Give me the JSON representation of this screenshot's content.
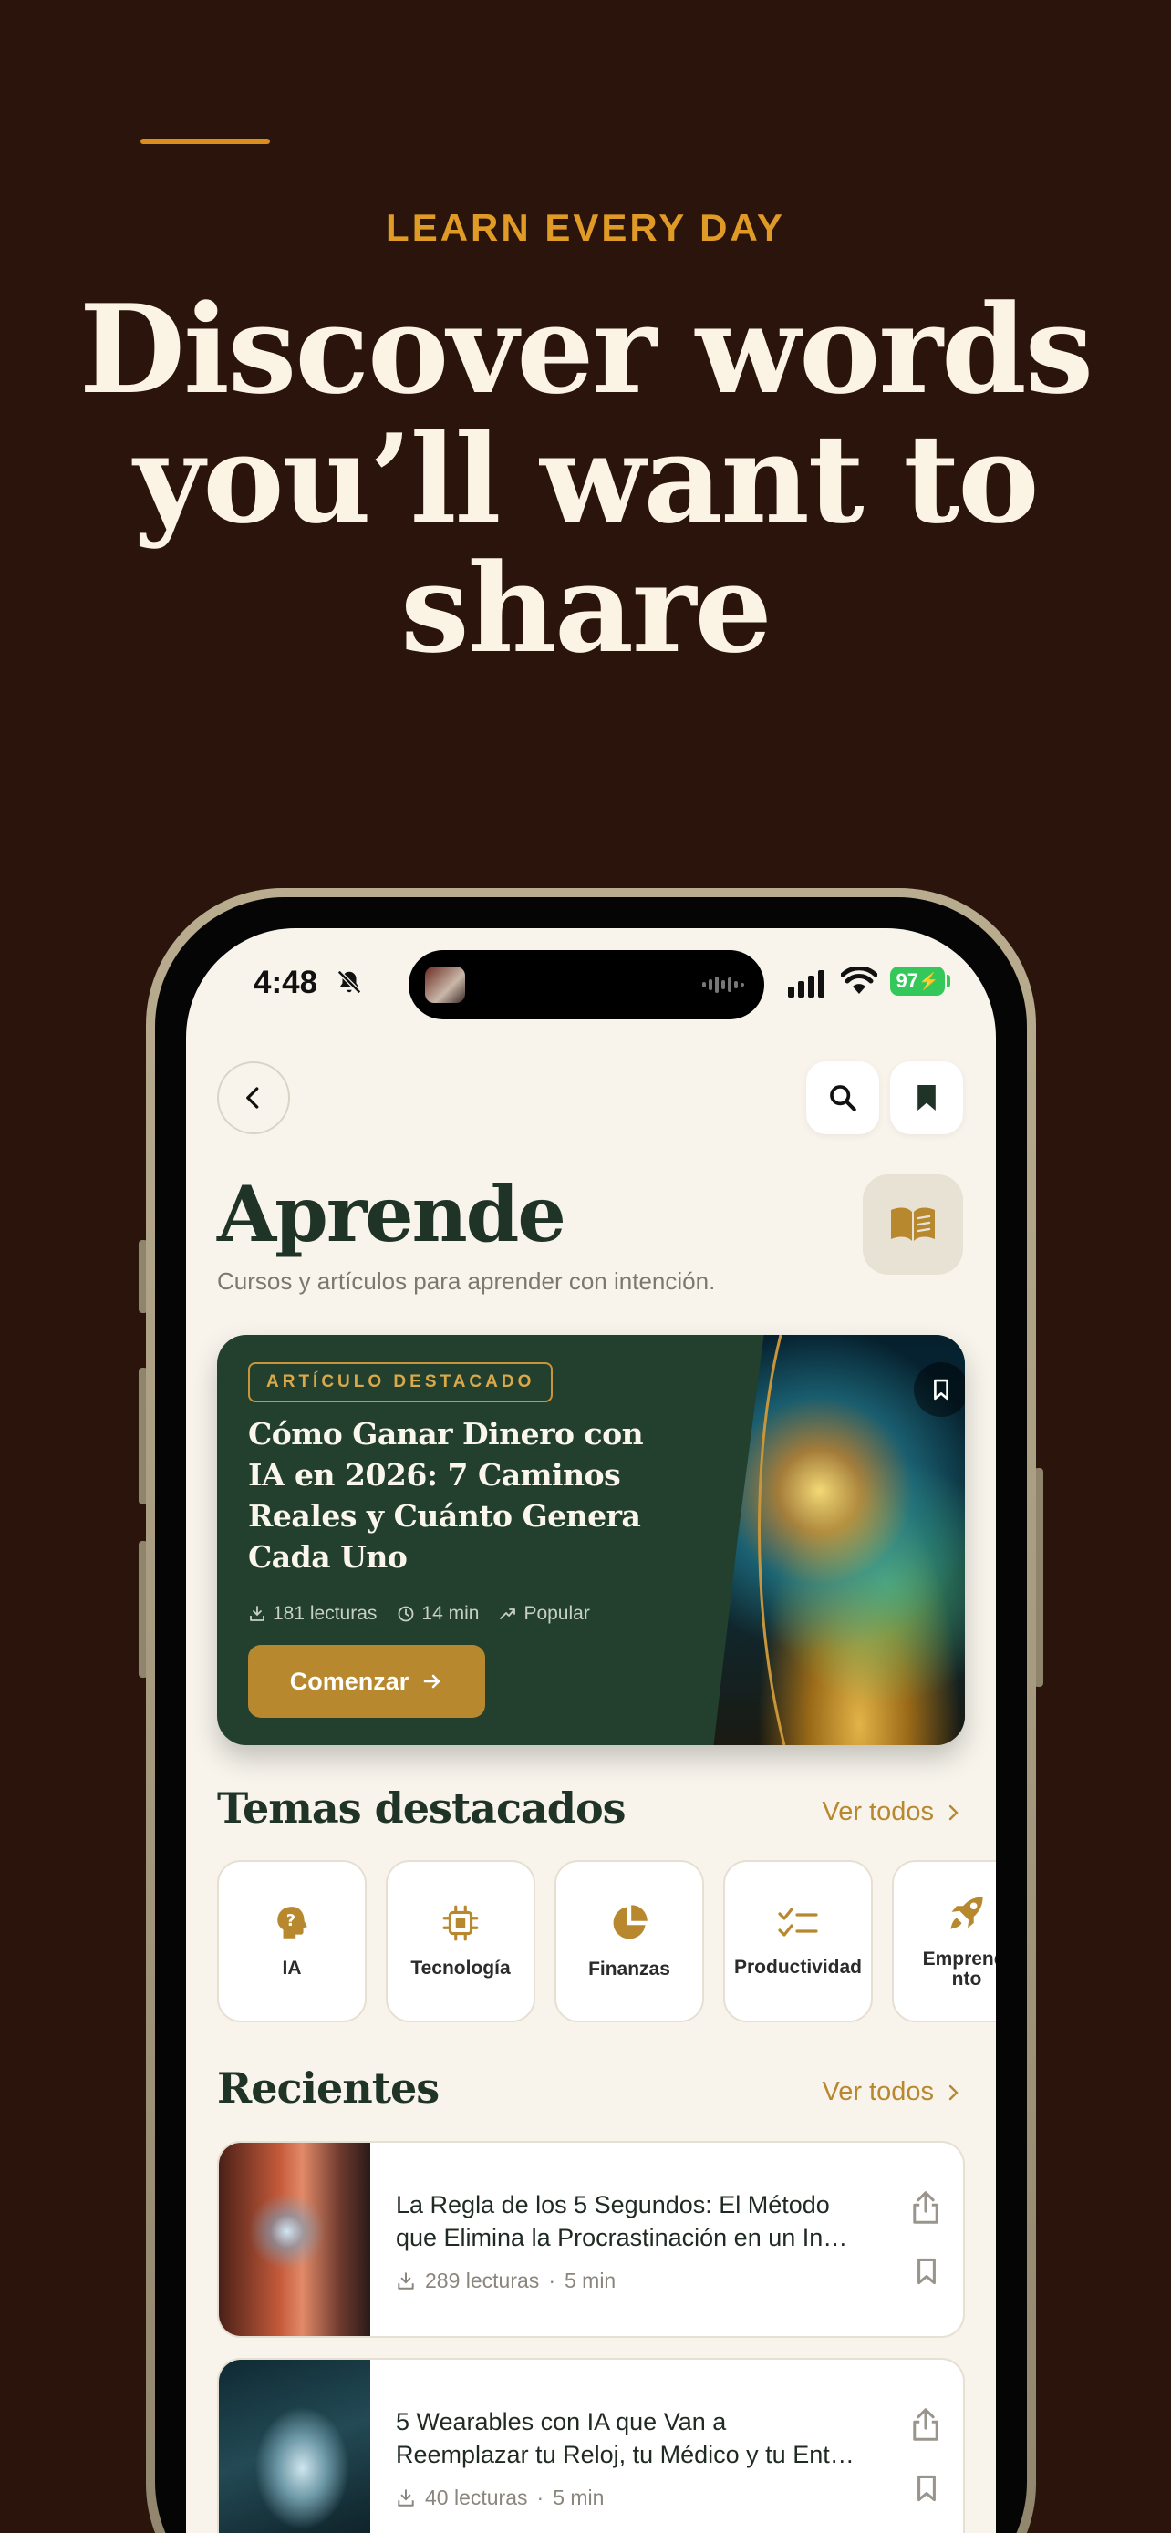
{
  "hero": {
    "eyebrow": "LEARN EVERY DAY",
    "headline_lines": [
      "Discover words",
      "you’ll want to",
      "share"
    ]
  },
  "status_bar": {
    "time": "4:48",
    "battery": "97"
  },
  "page": {
    "title": "Aprende",
    "subtitle": "Cursos y artículos para aprender con intención."
  },
  "featured": {
    "badge": "ARTÍCULO DESTACADO",
    "title_lines": [
      "Cómo Ganar Dinero con",
      "IA en 2026: 7 Caminos",
      "Reales y Cuánto Genera",
      "Cada Uno"
    ],
    "reads": "181 lecturas",
    "duration": "14 min",
    "tag": "Popular",
    "cta": "Comenzar"
  },
  "topics_section": {
    "title": "Temas destacados",
    "see_all": "Ver todos",
    "items": [
      {
        "label": "IA",
        "icon": "brain-question-icon"
      },
      {
        "label": "Tecnología",
        "icon": "chip-icon"
      },
      {
        "label": "Finanzas",
        "icon": "pie-chart-icon"
      },
      {
        "label": "Productividad",
        "icon": "checklist-icon"
      },
      {
        "label_lines": [
          "Emprendi",
          "nto"
        ],
        "icon": "rocket-icon"
      }
    ]
  },
  "recent_section": {
    "title": "Recientes",
    "see_all": "Ver todos",
    "items": [
      {
        "title_lines": [
          "La Regla de los 5 Segundos: El Método",
          "que Elimina la Procrastinación en un In…"
        ],
        "reads": "289 lecturas",
        "duration": "5 min"
      },
      {
        "title_lines": [
          "5 Wearables con IA que Van a",
          "Reemplazar tu Reloj, tu Médico y tu Ent…"
        ],
        "reads": "40 lecturas",
        "duration": "5 min"
      }
    ]
  },
  "colors": {
    "background": "#2a140c",
    "accent_gold": "#e09a26",
    "brand_green": "#23402e",
    "button_gold": "#b8882e",
    "screen_bg": "#f8f4ec"
  }
}
